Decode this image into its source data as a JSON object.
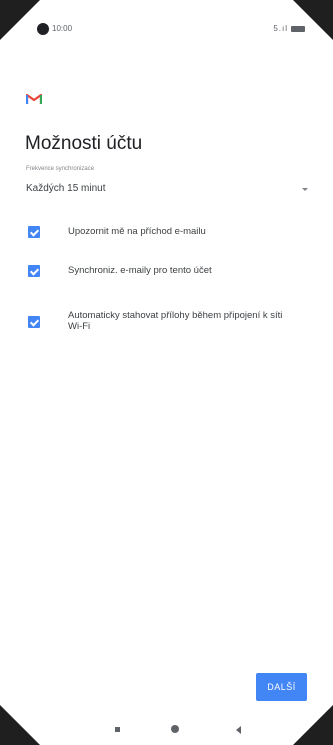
{
  "status_bar": {
    "time": "10:00",
    "signal": "5.ıl"
  },
  "app": {
    "logo_icon": "gmail-m-icon"
  },
  "header": {
    "title": "Možnosti účtu"
  },
  "sync": {
    "label": "Frekvence synchronizace",
    "value": "Každých 15 minut"
  },
  "options": [
    {
      "label": "Upozornit mě na příchod e-mailu",
      "checked": true
    },
    {
      "label": "Synchroniz. e-maily pro tento účet",
      "checked": true
    },
    {
      "label": "Automaticky stahovat přílohy během připojení k síti Wi-Fi",
      "checked": true
    }
  ],
  "footer": {
    "next_label": "DALŠÍ"
  },
  "colors": {
    "accent": "#4285f4",
    "text": "#202124",
    "secondary_text": "#80868b"
  }
}
